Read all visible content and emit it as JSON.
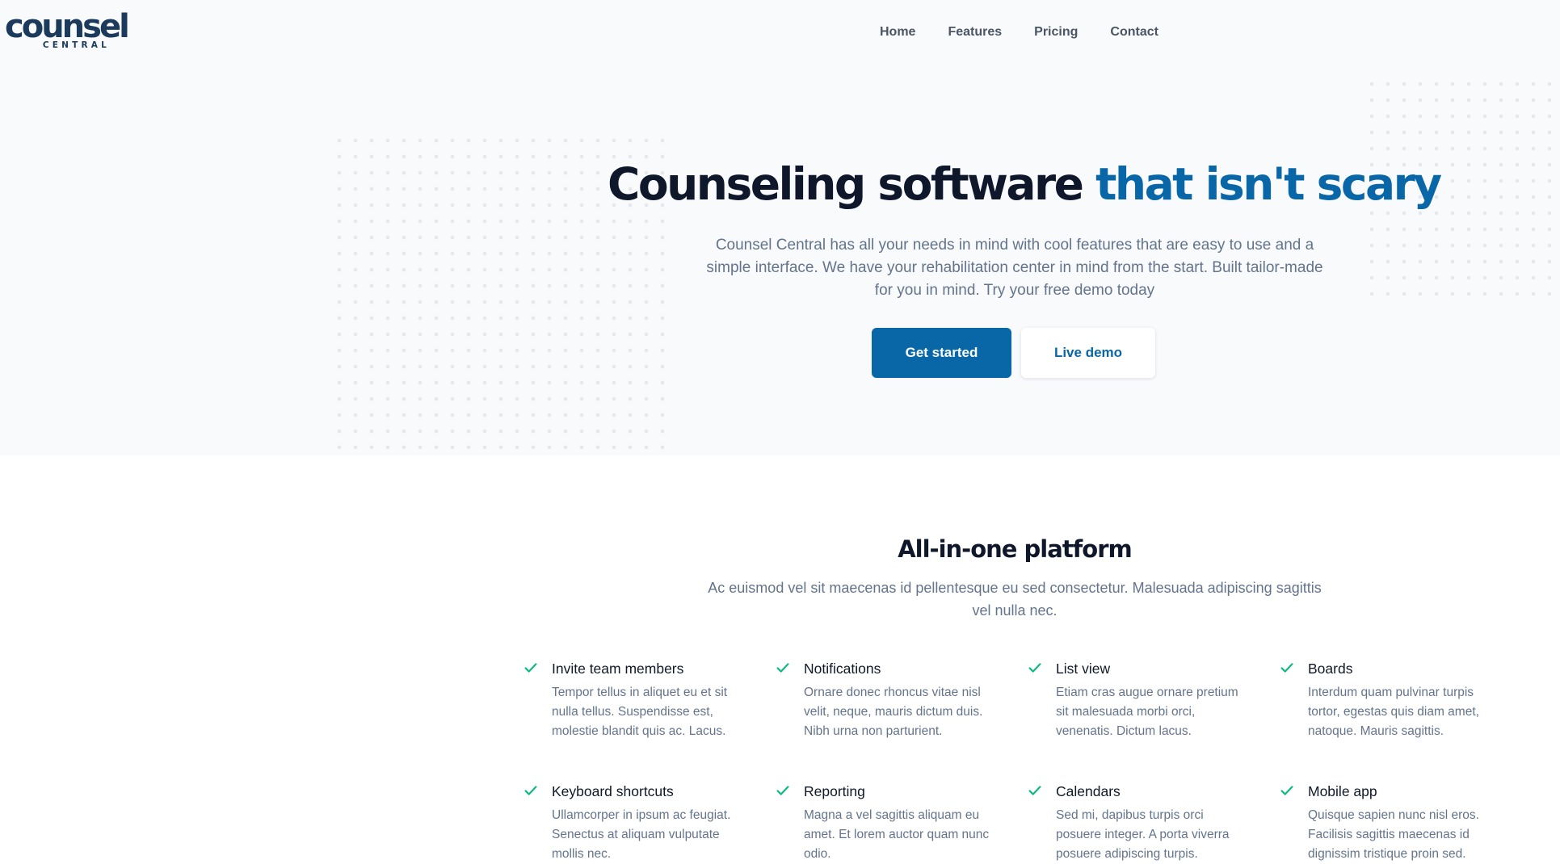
{
  "logo": {
    "main": "counsel",
    "sub": "CENTRAL"
  },
  "nav": {
    "items": [
      {
        "label": "Home"
      },
      {
        "label": "Features"
      },
      {
        "label": "Pricing"
      },
      {
        "label": "Contact"
      }
    ]
  },
  "hero": {
    "headline_main": "Counseling software ",
    "headline_accent": "that isn't scary",
    "lead": "Counsel Central has all your needs in mind with cool features that are easy to use and a simple interface. We have your rehabilitation center in mind from the start. Built tailor-made for you in mind. Try your free demo today",
    "primary_button": "Get started",
    "secondary_button": "Live demo"
  },
  "platform": {
    "title": "All-in-one platform",
    "subtitle": "Ac euismod vel sit maecenas id pellentesque eu sed consectetur. Malesuada adipiscing sagittis vel nulla nec."
  },
  "features": [
    {
      "title": "Invite team members",
      "description": "Tempor tellus in aliquet eu et sit nulla tellus. Suspendisse est, molestie blandit quis ac. Lacus."
    },
    {
      "title": "Notifications",
      "description": "Ornare donec rhoncus vitae nisl velit, neque, mauris dictum duis. Nibh urna non parturient."
    },
    {
      "title": "List view",
      "description": "Etiam cras augue ornare pretium sit malesuada morbi orci, venenatis. Dictum lacus."
    },
    {
      "title": "Boards",
      "description": "Interdum quam pulvinar turpis tortor, egestas quis diam amet, natoque. Mauris sagittis."
    },
    {
      "title": "Keyboard shortcuts",
      "description": "Ullamcorper in ipsum ac feugiat. Senectus at aliquam vulputate mollis nec."
    },
    {
      "title": "Reporting",
      "description": "Magna a vel sagittis aliquam eu amet. Et lorem auctor quam nunc odio."
    },
    {
      "title": "Calendars",
      "description": "Sed mi, dapibus turpis orci posuere integer. A porta viverra posuere adipiscing turpis."
    },
    {
      "title": "Mobile app",
      "description": "Quisque sapien nunc nisl eros. Facilisis sagittis maecenas id dignissim tristique proin sed."
    }
  ],
  "colors": {
    "brand": "#0967a8",
    "check": "#10b981",
    "hero_background": "#f8fafc"
  }
}
